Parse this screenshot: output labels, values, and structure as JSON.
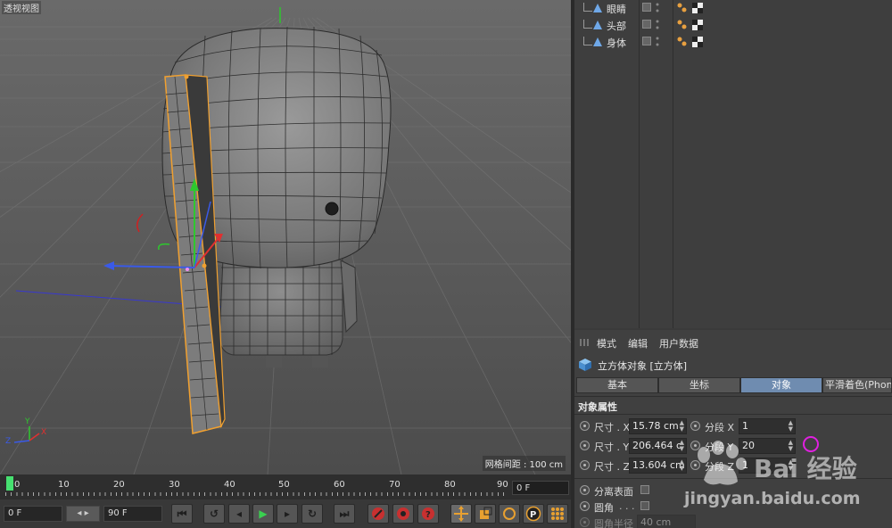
{
  "viewport": {
    "title": "透视视图",
    "grid_spacing": "网格间距 : 100 cm",
    "axis_labels": {
      "x": "X",
      "y": "Y",
      "z": "Z"
    }
  },
  "object_manager": {
    "objects": [
      {
        "name": "眼睛",
        "icon": "null-object-icon"
      },
      {
        "name": "头部",
        "icon": "null-object-icon"
      },
      {
        "name": "身体",
        "icon": "null-object-icon"
      }
    ]
  },
  "attributes": {
    "menu": [
      "模式",
      "编辑",
      "用户数据"
    ],
    "object_title": "立方体对象 [立方体]",
    "tabs": [
      "基本",
      "坐标",
      "对象",
      "平滑着色(Phon"
    ],
    "active_tab": "对象",
    "section_title": "对象属性",
    "props": {
      "size_x_label": "尺寸 . X",
      "size_x": "15.78 cm",
      "size_y_label": "尺寸 . Y",
      "size_y": "206.464 c",
      "size_z_label": "尺寸 . Z",
      "size_z": "13.604 cm",
      "seg_x_label": "分段 X",
      "seg_x": "1",
      "seg_y_label": "分段 Y",
      "seg_y": "20",
      "seg_z_label": "分段 Z",
      "seg_z": "1",
      "separate_label": "分离表面",
      "fillet_label": "圆角",
      "fillet_radius_label": "圆角半径",
      "fillet_radius": "40 cm"
    }
  },
  "timeline": {
    "ticks": [
      "0",
      "10",
      "20",
      "30",
      "40",
      "50",
      "60",
      "70",
      "80",
      "90"
    ],
    "current_frame_field": "0 F"
  },
  "transport": {
    "start_field": "0 F",
    "end_field": "90 F"
  },
  "watermark": {
    "brand": "Bai  经验",
    "url": "jingyan.baidu.com"
  },
  "colors": {
    "accent_tab": "#6f8cb0",
    "selection": "#f0a030",
    "playhead": "#46e070"
  }
}
